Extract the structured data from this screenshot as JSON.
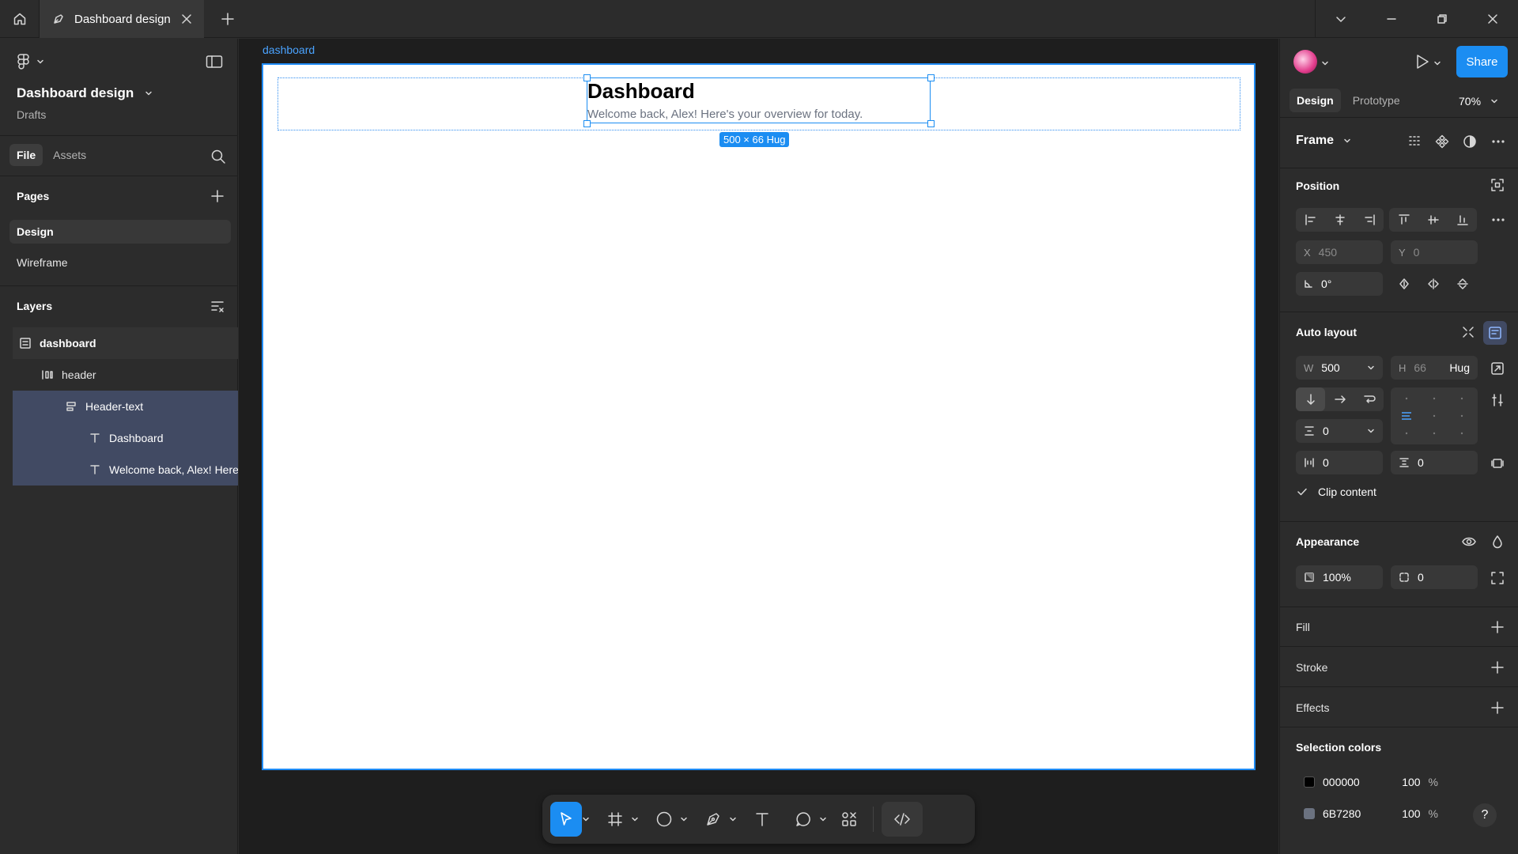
{
  "tab": {
    "title": "Dashboard design"
  },
  "left": {
    "file_name": "Dashboard design",
    "location": "Drafts",
    "file_tabs": [
      "File",
      "Assets"
    ],
    "pages_title": "Pages",
    "pages": [
      "Design",
      "Wireframe"
    ],
    "layers_title": "Layers",
    "layers": [
      "dashboard",
      "header",
      "Header-text",
      "Dashboard",
      "Welcome back, Alex! Here's your overview for today."
    ]
  },
  "canvas": {
    "frame_label": "dashboard",
    "header_title": "Dashboard",
    "header_subtitle": "Welcome back, Alex! Here's your overview for today.",
    "size_badge": "500 × 66 Hug"
  },
  "right": {
    "share": "Share",
    "tabs": [
      "Design",
      "Prototype"
    ],
    "zoom": "70%",
    "frame_label": "Frame",
    "position": {
      "title": "Position",
      "x_label": "X",
      "x": "450",
      "y_label": "Y",
      "y": "0",
      "rotation": "0°"
    },
    "auto_layout": {
      "title": "Auto layout",
      "w_label": "W",
      "w": "500",
      "h_label": "H",
      "h": "66",
      "h_mode": "Hug",
      "gap": "0",
      "pad_h": "0",
      "pad_v": "0",
      "clip": "Clip content"
    },
    "appearance": {
      "title": "Appearance",
      "opacity": "100%",
      "radius": "0"
    },
    "fill_title": "Fill",
    "stroke_title": "Stroke",
    "effects_title": "Effects",
    "selection_colors": {
      "title": "Selection colors",
      "items": [
        {
          "hex": "000000",
          "opacity": "100",
          "unit": "%",
          "color": "#000000"
        },
        {
          "hex": "6B7280",
          "opacity": "100",
          "unit": "%",
          "color": "#6B7280"
        }
      ]
    },
    "help": "?"
  },
  "colors": {
    "accent": "#1B8DF2",
    "panel": "#2C2C2C",
    "canvas": "#1E1E1E"
  }
}
